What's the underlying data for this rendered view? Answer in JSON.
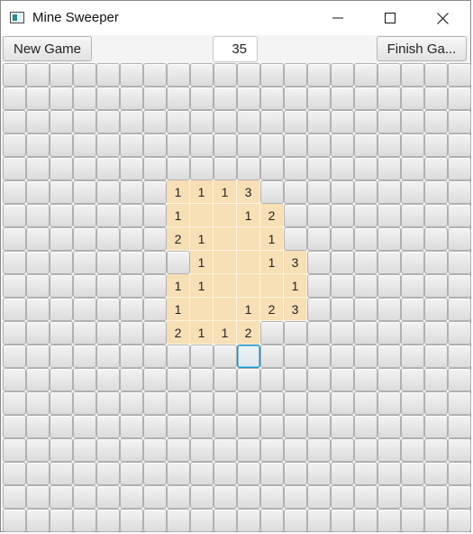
{
  "window": {
    "title": "Mine Sweeper",
    "icon": "app-window-icon",
    "controls": [
      "minimize-icon",
      "maximize-icon",
      "close-icon"
    ]
  },
  "toolbar": {
    "new_game_label": "New Game",
    "counter_value": "35",
    "finish_game_label": "Finish Ga..."
  },
  "board": {
    "rows": 20,
    "cols": 20,
    "revealed": [
      {
        "row": 5,
        "col": 7,
        "label": "1"
      },
      {
        "row": 5,
        "col": 8,
        "label": "1"
      },
      {
        "row": 5,
        "col": 9,
        "label": "1"
      },
      {
        "row": 5,
        "col": 10,
        "label": "3"
      },
      {
        "row": 6,
        "col": 7,
        "label": "1"
      },
      {
        "row": 6,
        "col": 8,
        "label": ""
      },
      {
        "row": 6,
        "col": 9,
        "label": ""
      },
      {
        "row": 6,
        "col": 10,
        "label": "1"
      },
      {
        "row": 6,
        "col": 11,
        "label": "2"
      },
      {
        "row": 7,
        "col": 7,
        "label": "2"
      },
      {
        "row": 7,
        "col": 8,
        "label": "1"
      },
      {
        "row": 7,
        "col": 9,
        "label": ""
      },
      {
        "row": 7,
        "col": 10,
        "label": ""
      },
      {
        "row": 7,
        "col": 11,
        "label": "1"
      },
      {
        "row": 8,
        "col": 8,
        "label": "1"
      },
      {
        "row": 8,
        "col": 9,
        "label": ""
      },
      {
        "row": 8,
        "col": 10,
        "label": ""
      },
      {
        "row": 8,
        "col": 11,
        "label": "1"
      },
      {
        "row": 8,
        "col": 12,
        "label": "3"
      },
      {
        "row": 9,
        "col": 7,
        "label": "1"
      },
      {
        "row": 9,
        "col": 8,
        "label": "1"
      },
      {
        "row": 9,
        "col": 9,
        "label": ""
      },
      {
        "row": 9,
        "col": 10,
        "label": ""
      },
      {
        "row": 9,
        "col": 11,
        "label": ""
      },
      {
        "row": 9,
        "col": 12,
        "label": "1"
      },
      {
        "row": 10,
        "col": 7,
        "label": "1"
      },
      {
        "row": 10,
        "col": 8,
        "label": ""
      },
      {
        "row": 10,
        "col": 9,
        "label": ""
      },
      {
        "row": 10,
        "col": 10,
        "label": "1"
      },
      {
        "row": 10,
        "col": 11,
        "label": "2"
      },
      {
        "row": 10,
        "col": 12,
        "label": "3"
      },
      {
        "row": 11,
        "col": 7,
        "label": "2"
      },
      {
        "row": 11,
        "col": 8,
        "label": "1"
      },
      {
        "row": 11,
        "col": 9,
        "label": "1"
      },
      {
        "row": 11,
        "col": 10,
        "label": "2"
      }
    ],
    "focused": {
      "row": 12,
      "col": 10
    }
  }
}
